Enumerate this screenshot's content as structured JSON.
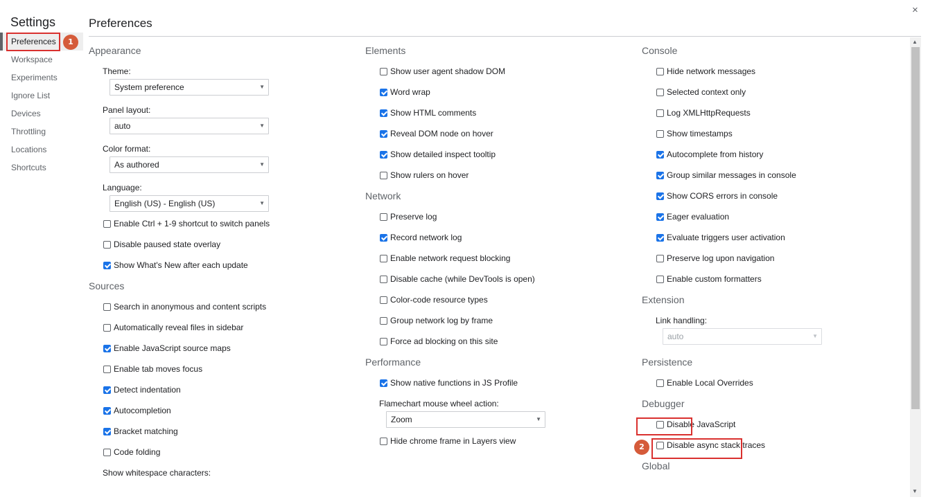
{
  "window": {
    "close_glyph": "×"
  },
  "sidebar": {
    "title": "Settings",
    "items": [
      {
        "label": "Preferences"
      },
      {
        "label": "Workspace"
      },
      {
        "label": "Experiments"
      },
      {
        "label": "Ignore List"
      },
      {
        "label": "Devices"
      },
      {
        "label": "Throttling"
      },
      {
        "label": "Locations"
      },
      {
        "label": "Shortcuts"
      }
    ]
  },
  "main": {
    "title": "Preferences"
  },
  "appearance": {
    "title": "Appearance",
    "theme_label": "Theme:",
    "theme_value": "System preference",
    "panel_layout_label": "Panel layout:",
    "panel_layout_value": "auto",
    "color_format_label": "Color format:",
    "color_format_value": "As authored",
    "language_label": "Language:",
    "language_value": "English (US) - English (US)",
    "checks": [
      {
        "label": "Enable Ctrl + 1-9 shortcut to switch panels",
        "checked": false
      },
      {
        "label": "Disable paused state overlay",
        "checked": false
      },
      {
        "label": "Show What's New after each update",
        "checked": true
      }
    ]
  },
  "sources": {
    "title": "Sources",
    "checks": [
      {
        "label": "Search in anonymous and content scripts",
        "checked": false
      },
      {
        "label": "Automatically reveal files in sidebar",
        "checked": false
      },
      {
        "label": "Enable JavaScript source maps",
        "checked": true
      },
      {
        "label": "Enable tab moves focus",
        "checked": false
      },
      {
        "label": "Detect indentation",
        "checked": true
      },
      {
        "label": "Autocompletion",
        "checked": true
      },
      {
        "label": "Bracket matching",
        "checked": true
      },
      {
        "label": "Code folding",
        "checked": false
      }
    ],
    "whitespace_label": "Show whitespace characters:"
  },
  "elements": {
    "title": "Elements",
    "checks": [
      {
        "label": "Show user agent shadow DOM",
        "checked": false
      },
      {
        "label": "Word wrap",
        "checked": true
      },
      {
        "label": "Show HTML comments",
        "checked": true
      },
      {
        "label": "Reveal DOM node on hover",
        "checked": true
      },
      {
        "label": "Show detailed inspect tooltip",
        "checked": true
      },
      {
        "label": "Show rulers on hover",
        "checked": false
      }
    ]
  },
  "network": {
    "title": "Network",
    "checks": [
      {
        "label": "Preserve log",
        "checked": false
      },
      {
        "label": "Record network log",
        "checked": true
      },
      {
        "label": "Enable network request blocking",
        "checked": false
      },
      {
        "label": "Disable cache (while DevTools is open)",
        "checked": false
      },
      {
        "label": "Color-code resource types",
        "checked": false
      },
      {
        "label": "Group network log by frame",
        "checked": false
      },
      {
        "label": "Force ad blocking on this site",
        "checked": false
      }
    ]
  },
  "performance": {
    "title": "Performance",
    "check_native": {
      "label": "Show native functions in JS Profile",
      "checked": true
    },
    "flamechart_label": "Flamechart mouse wheel action:",
    "flamechart_value": "Zoom",
    "check_chrome_frame": {
      "label": "Hide chrome frame in Layers view",
      "checked": false
    }
  },
  "console": {
    "title": "Console",
    "checks": [
      {
        "label": "Hide network messages",
        "checked": false
      },
      {
        "label": "Selected context only",
        "checked": false
      },
      {
        "label": "Log XMLHttpRequests",
        "checked": false
      },
      {
        "label": "Show timestamps",
        "checked": false
      },
      {
        "label": "Autocomplete from history",
        "checked": true
      },
      {
        "label": "Group similar messages in console",
        "checked": true
      },
      {
        "label": "Show CORS errors in console",
        "checked": true
      },
      {
        "label": "Eager evaluation",
        "checked": true
      },
      {
        "label": "Evaluate triggers user activation",
        "checked": true
      },
      {
        "label": "Preserve log upon navigation",
        "checked": false
      },
      {
        "label": "Enable custom formatters",
        "checked": false
      }
    ]
  },
  "extension": {
    "title": "Extension",
    "link_handling_label": "Link handling:",
    "link_handling_value": "auto"
  },
  "persistence": {
    "title": "Persistence",
    "checks": [
      {
        "label": "Enable Local Overrides",
        "checked": false
      }
    ]
  },
  "debugger": {
    "title": "Debugger",
    "checks": [
      {
        "label": "Disable JavaScript",
        "checked": false
      },
      {
        "label": "Disable async stack traces",
        "checked": false
      }
    ]
  },
  "global": {
    "title": "Global"
  },
  "annotations": {
    "badge_1": "1",
    "badge_2": "2",
    "highlight_color": "#d9302e",
    "badge_color": "#d55b3a"
  },
  "colors": {
    "checkbox_checked": "#1a73e8"
  }
}
